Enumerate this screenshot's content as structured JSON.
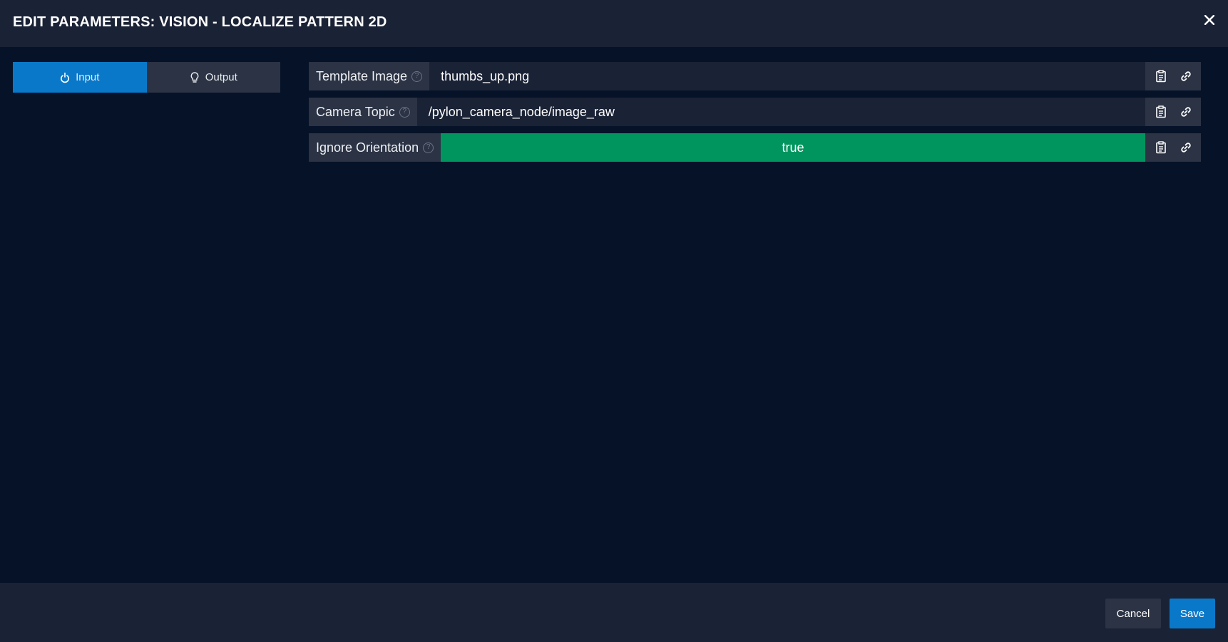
{
  "header": {
    "title": "EDIT PARAMETERS: VISION - LOCALIZE PATTERN 2D",
    "close_icon": "close-icon"
  },
  "tabs": [
    {
      "label": "Input",
      "icon": "power-icon",
      "active": true
    },
    {
      "label": "Output",
      "icon": "lightbulb-icon",
      "active": false
    }
  ],
  "params": [
    {
      "label": "Template Image",
      "value": "thumbs_up.png",
      "type": "text"
    },
    {
      "label": "Camera Topic",
      "value": "/pylon_camera_node/image_raw",
      "type": "text"
    },
    {
      "label": "Ignore Orientation",
      "value": "true",
      "type": "boolean"
    }
  ],
  "footer": {
    "cancel_label": "Cancel",
    "save_label": "Save"
  },
  "colors": {
    "accent": "#0a78c8",
    "bool_true": "#00955e",
    "background": "#061228",
    "panel": "#1a2235"
  }
}
